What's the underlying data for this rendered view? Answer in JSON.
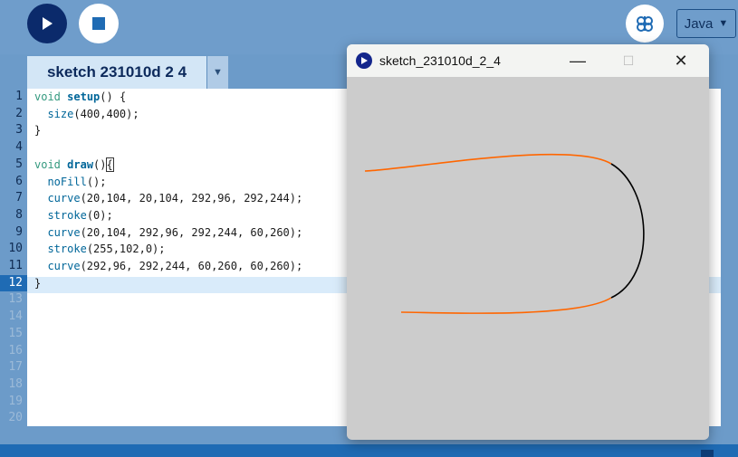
{
  "toolbar": {
    "run_icon": "play-icon",
    "stop_icon": "stop-icon",
    "debug_icon": "butterfly-debug-icon",
    "mode_label": "Java",
    "mode_arrow": "▼"
  },
  "tab": {
    "label": "sketch 231010d 2 4",
    "menu_arrow": "▼"
  },
  "editor": {
    "line_numbers": [
      "1",
      "2",
      "3",
      "4",
      "5",
      "6",
      "7",
      "8",
      "9",
      "10",
      "11",
      "12",
      "13",
      "14",
      "15",
      "16",
      "17",
      "18",
      "19",
      "20"
    ],
    "current_line": "12"
  },
  "sketch_window": {
    "title": "sketch_231010d_2_4",
    "minimize": "—",
    "maximize": "☐",
    "close": "✕",
    "background": "#cccccc",
    "curve_colors": {
      "orange": "#ff6600",
      "black": "#000000"
    }
  },
  "colors": {
    "keyword": "#33997e",
    "function": "#006699",
    "accent": "#1f6bb4"
  }
}
